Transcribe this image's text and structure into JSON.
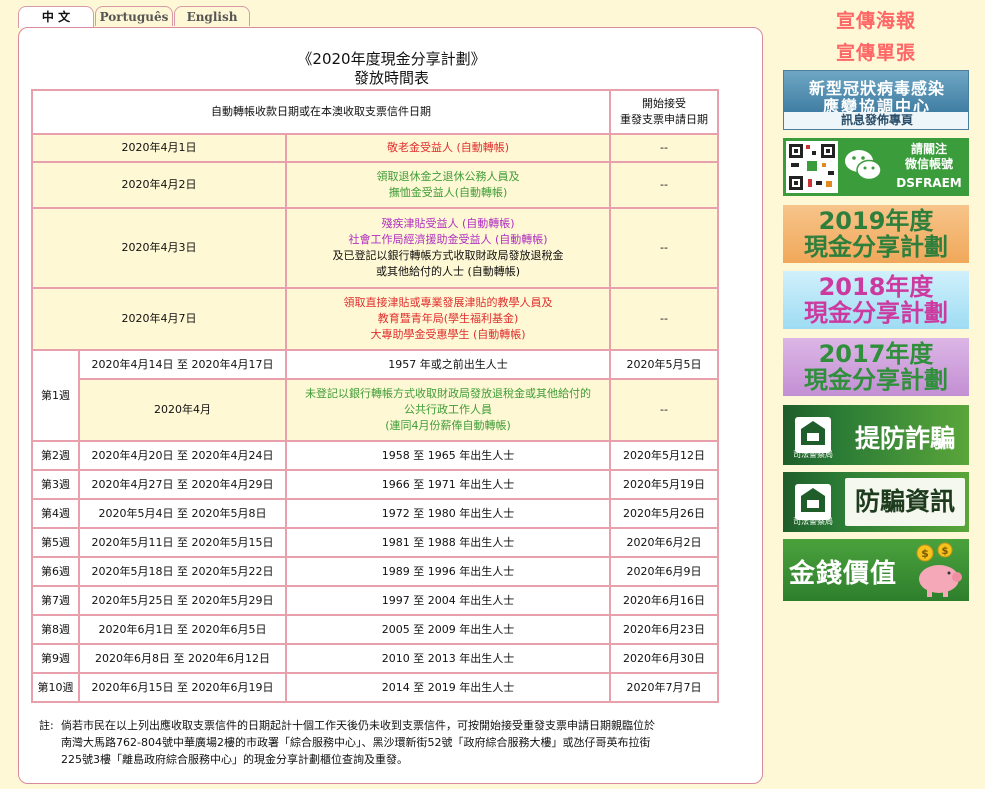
{
  "tabs": [
    "中 文",
    "Português",
    "English"
  ],
  "title_line1": "《2020年度現金分享計劃》",
  "title_line2": "發放時間表",
  "table": {
    "header_col1": "自動轉帳收款日期或在本澳收取支票信件日期",
    "header_col3_line1": "開始接受",
    "header_col3_line2": "重發支票申請日期",
    "dash": "--",
    "rows_top": [
      {
        "date": "2020年4月1日",
        "lines": [
          {
            "t": "敬老金受益人 (自動轉帳)",
            "c": "red"
          }
        ]
      },
      {
        "date": "2020年4月2日",
        "lines": [
          {
            "t": "領取退休金之退休公務人員及",
            "c": "grn"
          },
          {
            "t": "撫恤金受益人(自動轉帳)",
            "c": "grn"
          }
        ]
      },
      {
        "date": "2020年4月3日",
        "lines": [
          {
            "t": "殘疾津貼受益人 (自動轉帳)",
            "c": "pur"
          },
          {
            "t": "社會工作局經濟援助金受益人 (自動轉帳)",
            "c": "pur"
          },
          {
            "t": "及已登記以銀行轉帳方式收取財政局發放退稅金",
            "c": "blk"
          },
          {
            "t": "或其他給付的人士 (自動轉帳)",
            "c": "blk"
          }
        ]
      },
      {
        "date": "2020年4月7日",
        "lines": [
          {
            "t": "領取直接津貼或專業發展津貼的教學人員及",
            "c": "red"
          },
          {
            "t": "教育暨青年局(學生福利基金)",
            "c": "red"
          },
          {
            "t": "大專助學金受惠學生 (自動轉帳)",
            "c": "red"
          }
        ]
      }
    ],
    "week1_label": "第1週",
    "week1_row1": {
      "date": "2020年4月14日 至 2020年4月17日",
      "desc": "1957 年或之前出生人士",
      "reissue": "2020年5月5日"
    },
    "week1_row2": {
      "date": "2020年4月",
      "lines": [
        "未登記以銀行轉帳方式收取財政局發放退稅金或其他給付的",
        "公共行政工作人員",
        "(連同4月份薪俸自動轉帳)"
      ]
    },
    "weeks": [
      {
        "week": "第2週",
        "date": "2020年4月20日 至 2020年4月24日",
        "desc": "1958 至 1965 年出生人士",
        "reissue": "2020年5月12日"
      },
      {
        "week": "第3週",
        "date": "2020年4月27日 至 2020年4月29日",
        "desc": "1966 至 1971 年出生人士",
        "reissue": "2020年5月19日"
      },
      {
        "week": "第4週",
        "date": "2020年5月4日 至 2020年5月8日",
        "desc": "1972 至 1980 年出生人士",
        "reissue": "2020年5月26日"
      },
      {
        "week": "第5週",
        "date": "2020年5月11日 至 2020年5月15日",
        "desc": "1981 至 1988 年出生人士",
        "reissue": "2020年6月2日"
      },
      {
        "week": "第6週",
        "date": "2020年5月18日 至 2020年5月22日",
        "desc": "1989 至 1996 年出生人士",
        "reissue": "2020年6月9日"
      },
      {
        "week": "第7週",
        "date": "2020年5月25日 至 2020年5月29日",
        "desc": "1997 至 2004 年出生人士",
        "reissue": "2020年6月16日"
      },
      {
        "week": "第8週",
        "date": "2020年6月1日 至 2020年6月5日",
        "desc": "2005 至 2009 年出生人士",
        "reissue": "2020年6月23日"
      },
      {
        "week": "第9週",
        "date": "2020年6月8日 至 2020年6月12日",
        "desc": "2010 至 2013 年出生人士",
        "reissue": "2020年6月30日"
      },
      {
        "week": "第10週",
        "date": "2020年6月15日 至 2020年6月19日",
        "desc": "2014 至 2019 年出生人士",
        "reissue": "2020年7月7日"
      }
    ]
  },
  "note_label": "註:",
  "note_lines": [
    "倘若市民在以上列出應收取支票信件的日期起計十個工作天後仍未收到支票信件，可按開始接受重發支票申請日期親臨位於",
    "南灣大馬路762-804號中華廣場2樓的市政署「綜合服務中心」、黑沙環新街52號「政府綜合服務大樓」或氹仔哥英布拉街",
    "225號3樓「離島政府綜合服務中心」的現金分享計劃櫃位查詢及重發。"
  ],
  "sidebar": {
    "promo_poster": "宣傳海報",
    "promo_flyer": "宣傳單張",
    "covid_line1": "新型冠狀病毒感染",
    "covid_line2": "應變協調中心",
    "covid_line3": "訊息發佈專頁",
    "wechat_line1": "請關注",
    "wechat_line2": "微信帳號",
    "wechat_line3": "DSFRAEM",
    "y2019_l1": "2019年度",
    "y2019_l2": "現金分享計劃",
    "y2018_l1": "2018年度",
    "y2018_l2": "現金分享計劃",
    "y2017_l1": "2017年度",
    "y2017_l2": "現金分享計劃",
    "police_label": "司法警察局",
    "fraud_prevent": "提防詐騙",
    "fraud_info": "防騙資訊",
    "money_value": "金錢價值"
  }
}
